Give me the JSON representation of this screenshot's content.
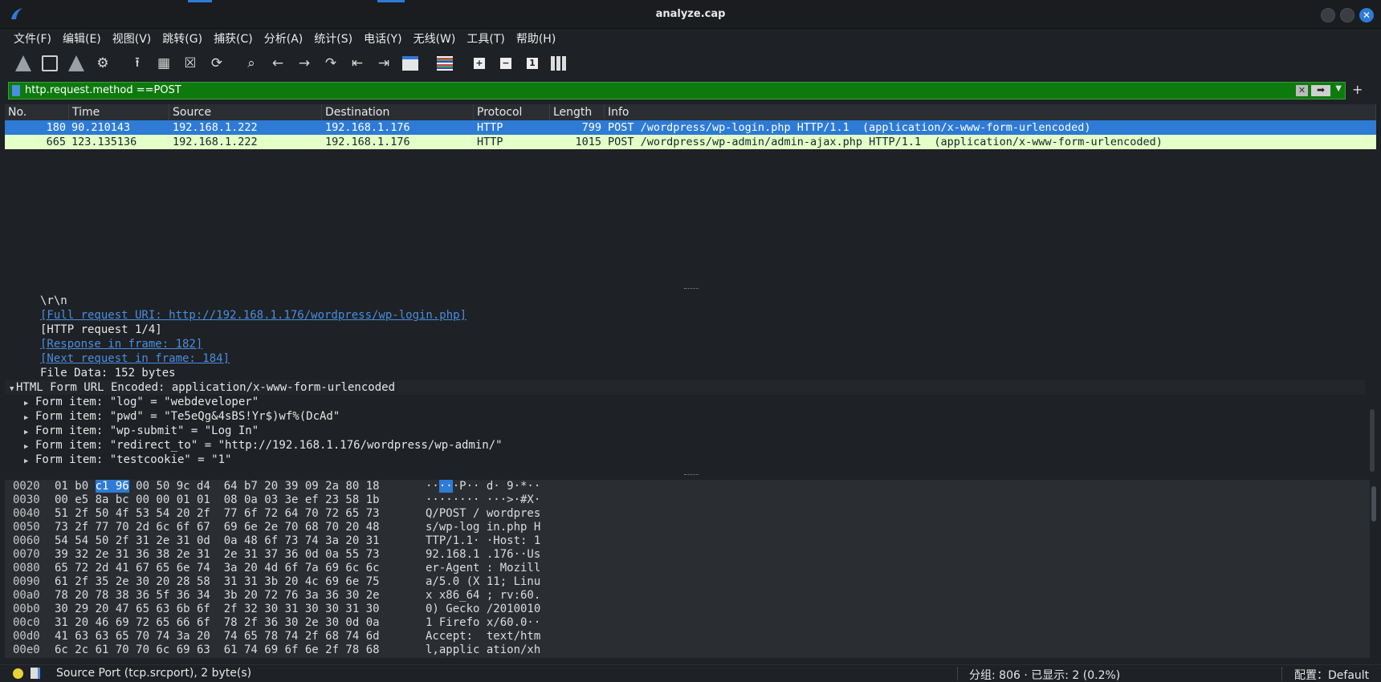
{
  "window": {
    "title": "analyze.cap"
  },
  "menu": [
    "文件(F)",
    "编辑(E)",
    "视图(V)",
    "跳转(G)",
    "捕获(C)",
    "分析(A)",
    "统计(S)",
    "电话(Y)",
    "无线(W)",
    "工具(T)",
    "帮助(H)"
  ],
  "filter": {
    "value": "http.request.method ==POST"
  },
  "packet_list": {
    "columns": [
      "No.",
      "Time",
      "Source",
      "Destination",
      "Protocol",
      "Length",
      "Info"
    ],
    "rows": [
      {
        "no": "180",
        "time": "90.210143",
        "source": "192.168.1.222",
        "destination": "192.168.1.176",
        "protocol": "HTTP",
        "length": "799",
        "info": "POST /wordpress/wp-login.php HTTP/1.1  (application/x-www-form-urlencoded)"
      },
      {
        "no": "665",
        "time": "123.135136",
        "source": "192.168.1.222",
        "destination": "192.168.1.176",
        "protocol": "HTTP",
        "length": "1015",
        "info": "POST /wordpress/wp-admin/admin-ajax.php HTTP/1.1  (application/x-www-form-urlencoded)"
      }
    ]
  },
  "details": {
    "crlf": "\\r\\n",
    "full_uri": "[Full request URI: http://192.168.1.176/wordpress/wp-login.php]",
    "request_num": "[HTTP request 1/4]",
    "response_frame": "[Response in frame: 182]",
    "next_request": "[Next request in frame: 184]",
    "file_data": "File Data: 152 bytes",
    "form_header": "HTML Form URL Encoded: application/x-www-form-urlencoded",
    "form_items": [
      "Form item: \"log\" = \"webdeveloper\"",
      "Form item: \"pwd\" = \"Te5eQg&4sBS!Yr$)wf%(DcAd\"",
      "Form item: \"wp-submit\" = \"Log In\"",
      "Form item: \"redirect_to\" = \"http://192.168.1.176/wordpress/wp-admin/\"",
      "Form item: \"testcookie\" = \"1\""
    ]
  },
  "bytes": [
    {
      "off": "0020",
      "hex_pre": "01 b0 ",
      "hex_sel": "c1 96",
      "hex_post": " 00 50 9c d4  64 b7 20 39 09 2a 80 18",
      "asc_pre": "··",
      "asc_sel": "··",
      "asc_post": "·P·· d· 9·*··"
    },
    {
      "off": "0030",
      "hex_pre": "00 e5 8a bc 00 00 01 01  08 0a 03 3e ef 23 58 1b",
      "hex_sel": "",
      "hex_post": "",
      "asc_pre": "········ ···>·#X·",
      "asc_sel": "",
      "asc_post": ""
    },
    {
      "off": "0040",
      "hex_pre": "51 2f 50 4f 53 54 20 2f  77 6f 72 64 70 72 65 73",
      "hex_sel": "",
      "hex_post": "",
      "asc_pre": "Q/POST / wordpres",
      "asc_sel": "",
      "asc_post": ""
    },
    {
      "off": "0050",
      "hex_pre": "73 2f 77 70 2d 6c 6f 67  69 6e 2e 70 68 70 20 48",
      "hex_sel": "",
      "hex_post": "",
      "asc_pre": "s/wp-log in.php H",
      "asc_sel": "",
      "asc_post": ""
    },
    {
      "off": "0060",
      "hex_pre": "54 54 50 2f 31 2e 31 0d  0a 48 6f 73 74 3a 20 31",
      "hex_sel": "",
      "hex_post": "",
      "asc_pre": "TTP/1.1· ·Host: 1",
      "asc_sel": "",
      "asc_post": ""
    },
    {
      "off": "0070",
      "hex_pre": "39 32 2e 31 36 38 2e 31  2e 31 37 36 0d 0a 55 73",
      "hex_sel": "",
      "hex_post": "",
      "asc_pre": "92.168.1 .176··Us",
      "asc_sel": "",
      "asc_post": ""
    },
    {
      "off": "0080",
      "hex_pre": "65 72 2d 41 67 65 6e 74  3a 20 4d 6f 7a 69 6c 6c",
      "hex_sel": "",
      "hex_post": "",
      "asc_pre": "er-Agent : Mozill",
      "asc_sel": "",
      "asc_post": ""
    },
    {
      "off": "0090",
      "hex_pre": "61 2f 35 2e 30 20 28 58  31 31 3b 20 4c 69 6e 75",
      "hex_sel": "",
      "hex_post": "",
      "asc_pre": "a/5.0 (X 11; Linu",
      "asc_sel": "",
      "asc_post": ""
    },
    {
      "off": "00a0",
      "hex_pre": "78 20 78 38 36 5f 36 34  3b 20 72 76 3a 36 30 2e",
      "hex_sel": "",
      "hex_post": "",
      "asc_pre": "x x86_64 ; rv:60.",
      "asc_sel": "",
      "asc_post": ""
    },
    {
      "off": "00b0",
      "hex_pre": "30 29 20 47 65 63 6b 6f  2f 32 30 31 30 30 31 30",
      "hex_sel": "",
      "hex_post": "",
      "asc_pre": "0) Gecko /2010010",
      "asc_sel": "",
      "asc_post": ""
    },
    {
      "off": "00c0",
      "hex_pre": "31 20 46 69 72 65 66 6f  78 2f 36 30 2e 30 0d 0a",
      "hex_sel": "",
      "hex_post": "",
      "asc_pre": "1 Firefo x/60.0··",
      "asc_sel": "",
      "asc_post": ""
    },
    {
      "off": "00d0",
      "hex_pre": "41 63 63 65 70 74 3a 20  74 65 78 74 2f 68 74 6d",
      "hex_sel": "",
      "hex_post": "",
      "asc_pre": "Accept:  text/htm",
      "asc_sel": "",
      "asc_post": ""
    },
    {
      "off": "00e0",
      "hex_pre": "6c 2c 61 70 70 6c 69 63  61 74 69 6f 6e 2f 78 68",
      "hex_sel": "",
      "hex_post": "",
      "asc_pre": "l,applic ation/xh",
      "asc_sel": "",
      "asc_post": ""
    }
  ],
  "status": {
    "field": "Source Port (tcp.srcport), 2 byte(s)",
    "packets": "分组: 806 · 已显示: 2 (0.2%)",
    "profile": "配置：Default"
  }
}
